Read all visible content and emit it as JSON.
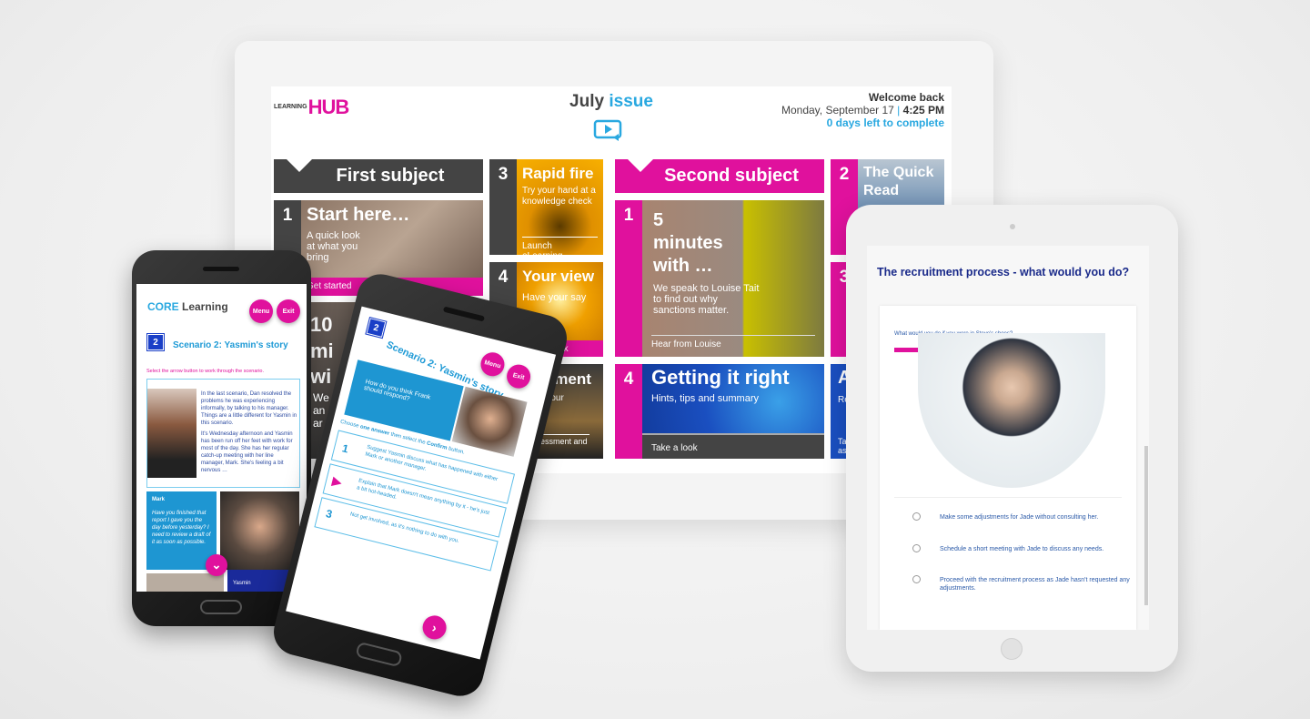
{
  "hub": {
    "logo_small": "LEARNING",
    "logo_big": "HUB",
    "title_a": "July",
    "title_b": "issue",
    "welcome": "Welcome back",
    "date": "Monday, September 17",
    "sep": "|",
    "time": "4:25 PM",
    "days_left": "0 days left to complete",
    "first_subject": "First subject",
    "second_subject": "Second subject",
    "tiles": [
      {
        "num": "1",
        "title": "Start here…",
        "text": "A quick look at what you bring",
        "foot": "Get started"
      },
      {
        "num": "3",
        "title": "Rapid fire",
        "text": "Try your hand at a knowledge check",
        "foot": "Launch eLearning"
      },
      {
        "num": "4",
        "title": "Your view",
        "text": "Have your say",
        "foot": "Take a look"
      },
      {
        "num": "",
        "title": "ssessment",
        "text": "e to test your owledge",
        "foot": "ake the assessment and ain insight"
      },
      {
        "num": "10",
        "title": "mi wi",
        "text": "We an ar",
        "foot": ""
      },
      {
        "num": "1",
        "title": "5 minutes with …",
        "text": "We speak to Louise Tait to find out why sanctions matter.",
        "foot": "Hear from Louise"
      },
      {
        "num": "4",
        "title": "Getting it right",
        "text": "Hints, tips and summary",
        "foot": "Take a look"
      },
      {
        "num": "2",
        "title": "The Quick Read",
        "text": "",
        "foot": ""
      },
      {
        "num": "3",
        "title": "",
        "text": "",
        "foot": ""
      },
      {
        "num": "",
        "title": "A",
        "text": "Re",
        "foot": "Tal ass"
      }
    ]
  },
  "phone1": {
    "brand_a": "CORE",
    "brand_b": " Learning",
    "menu": "Menu",
    "exit": "Exit",
    "badge": "2",
    "scenario": "Scenario 2: Yasmin's story",
    "instruction": "Select the arrow button to work through the scenario.",
    "para1": "In the last scenario, Dan resolved the problems he was experiencing informally, by talking to his manager. Things are a little different for Yasmin in this scenario.",
    "para2": "It's Wednesday afternoon and Yasmin has been run off her feet with work for most of the day.  She has her regular catch-up meeting with her line manager, Mark. She's feeling a bit nervous …",
    "speaker": "Mark",
    "quote": "Have you finished that report I gave you the day before yesterday? I need to review a draft of it as soon as possible.",
    "next_speaker": "Yasmin"
  },
  "phone2": {
    "badge": "2",
    "scenario": "Scenario 2: Yasmin's story",
    "menu": "Menu",
    "exit": "Exit",
    "question": "How do you think Frank should respond?",
    "instruction_a": "Choose ",
    "instruction_b": "one answer",
    "instruction_c": " then select the ",
    "instruction_d": "Confirm",
    "instruction_e": " button.",
    "options": [
      {
        "num": "1",
        "text": "Suggest Yasmin discuss what has happened with either Mark or another manager."
      },
      {
        "num": "",
        "text": "Explain that Mark doesn't mean anything by it - he's just a bit hot-headed."
      },
      {
        "num": "3",
        "text": "Not get involved, as it's nothing to do with you."
      }
    ],
    "next": "›"
  },
  "tablet": {
    "title": "The recruitment process - what would you do?",
    "question": "What would you do if you were in Steve's shoes?",
    "options": [
      "Make some adjustments for Jade without consulting her.",
      "Schedule a short meeting with Jade to discuss any needs.",
      "Proceed with the recruitment process as Jade hasn't requested any adjustments."
    ]
  },
  "colors": {
    "magenta": "#e0119d",
    "blue": "#29a8e0",
    "dark": "#444444",
    "navy": "#1a2a8a"
  }
}
